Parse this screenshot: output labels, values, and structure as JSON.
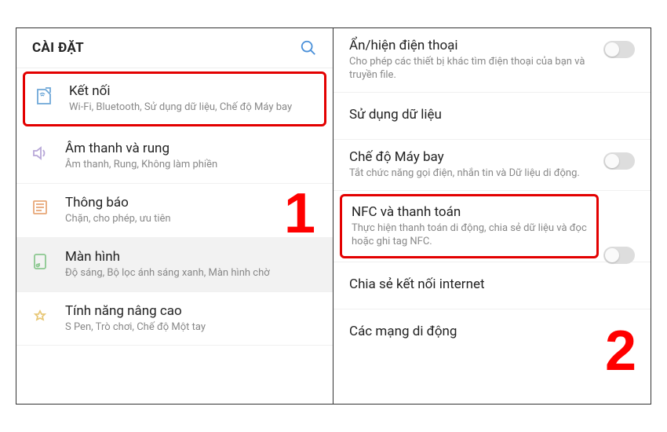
{
  "left": {
    "header": "CÀI ĐẶT",
    "items": [
      {
        "title": "Kết nối",
        "subtitle": "Wi-Fi, Bluetooth, Sử dụng dữ liệu, Chế độ Máy bay"
      },
      {
        "title": "Âm thanh và rung",
        "subtitle": "Âm thanh, Rung, Không làm phiền"
      },
      {
        "title": "Thông báo",
        "subtitle": "Chặn, cho phép, ưu tiên"
      },
      {
        "title": "Màn hình",
        "subtitle": "Độ sáng, Bộ lọc ánh sáng xanh, Màn hình chờ"
      },
      {
        "title": "Tính năng nâng cao",
        "subtitle": "S Pen, Trò chơi, Chế độ Một tay"
      }
    ]
  },
  "right": {
    "items": [
      {
        "title": "Ẩn/hiện điện thoại",
        "subtitle": "Cho phép các thiết bị khác tìm điện thoại của bạn và truyền file."
      },
      {
        "title": "Sử dụng dữ liệu",
        "subtitle": ""
      },
      {
        "title": "Chế độ Máy bay",
        "subtitle": "Tắt chức năng gọi điện, nhắn tin và Dữ liệu di động."
      },
      {
        "title": "NFC và thanh toán",
        "subtitle": "Thực hiện thanh toán di động, chia sẻ dữ liệu và đọc hoặc ghi tag NFC."
      },
      {
        "title": "Chia sẻ kết nối internet",
        "subtitle": ""
      },
      {
        "title": "Các mạng di động",
        "subtitle": ""
      }
    ]
  },
  "annotations": {
    "num1": "1",
    "num2": "2"
  }
}
